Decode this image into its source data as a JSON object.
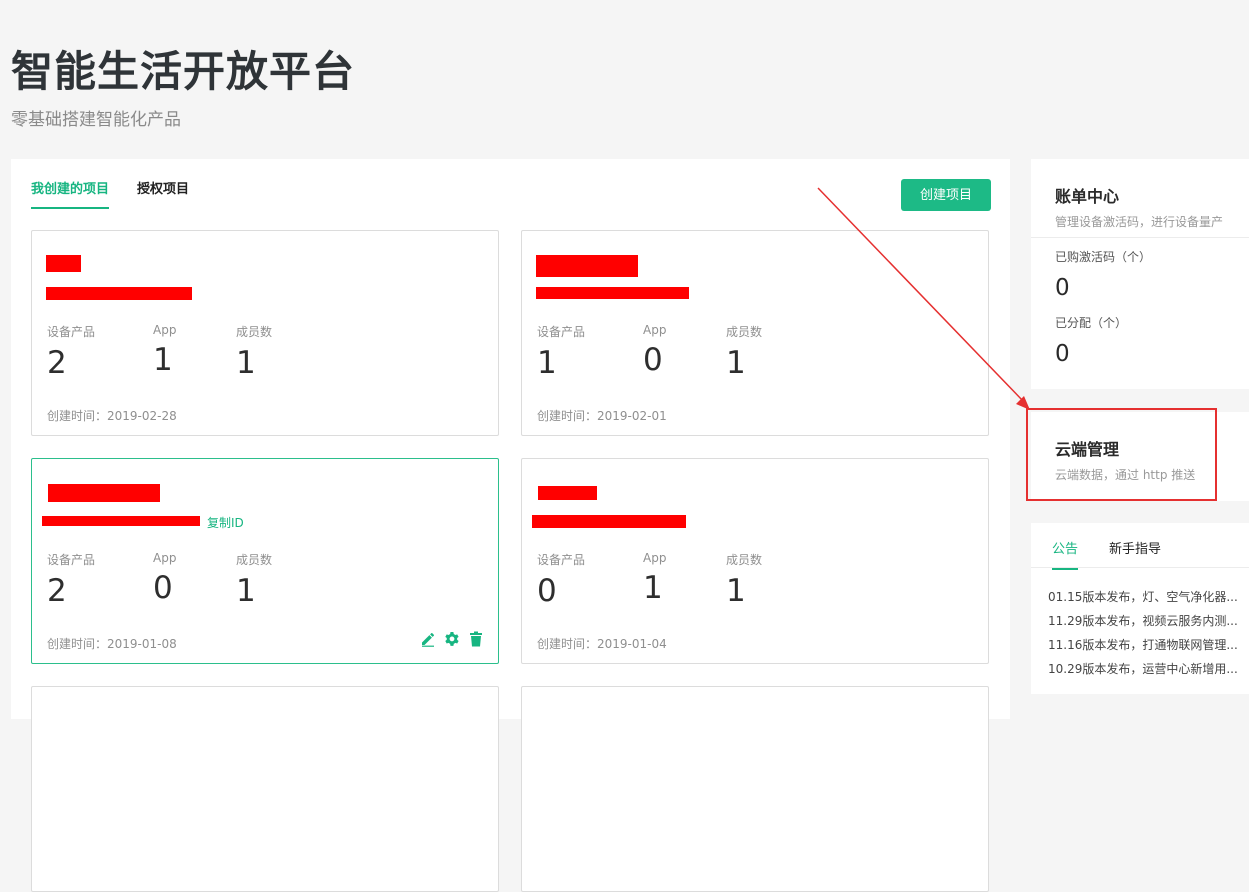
{
  "header": {
    "title": "智能生活开放平台",
    "subtitle": "零基础搭建智能化产品"
  },
  "tabs": [
    {
      "label": "我创建的项目",
      "active": true
    },
    {
      "label": "授权项目",
      "active": false
    }
  ],
  "create_button": "创建项目",
  "stat_labels": {
    "devices": "设备产品",
    "app": "App",
    "members": "成员数"
  },
  "projects": [
    {
      "devices": "2",
      "app": "1",
      "members": "1",
      "created": "创建时间：2019-02-28"
    },
    {
      "devices": "1",
      "app": "0",
      "members": "1",
      "created": "创建时间：2019-02-01"
    },
    {
      "devices": "2",
      "app": "0",
      "members": "1",
      "created": "创建时间：2019-01-08",
      "copy_id": "复制ID",
      "selected": true
    },
    {
      "devices": "0",
      "app": "1",
      "members": "1",
      "created": "创建时间：2019-01-04"
    }
  ],
  "billing": {
    "title": "账单中心",
    "desc": "管理设备激活码，进行设备量产",
    "purchased_label": "已购激活码（个）",
    "purchased_value": "0",
    "allocated_label": "已分配（个）",
    "allocated_value": "0"
  },
  "cloud": {
    "title": "云端管理",
    "desc": "云端数据，通过 http 推送"
  },
  "notices": {
    "tabs": [
      {
        "label": "公告",
        "active": true
      },
      {
        "label": "新手指导",
        "active": false
      }
    ],
    "items": [
      "01.15版本发布，灯、空气净化器...",
      "11.29版本发布，视频云服务内测...",
      "11.16版本发布，打通物联网管理...",
      "10.29版本发布，运营中心新增用..."
    ]
  },
  "colors": {
    "accent": "#1dba86",
    "annotation": "#e53030",
    "redaction": "#ff0000"
  },
  "icons": [
    "edit-icon",
    "gear-icon",
    "trash-icon"
  ]
}
